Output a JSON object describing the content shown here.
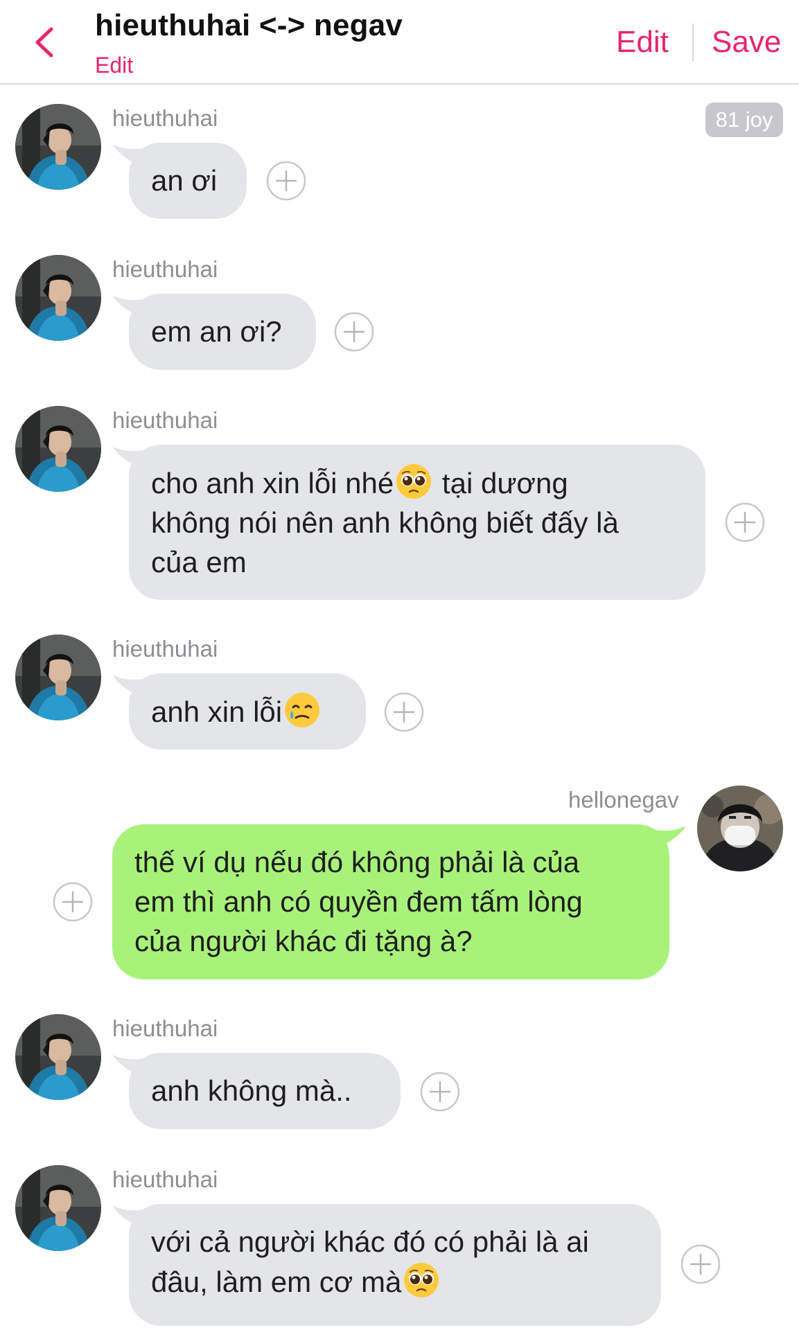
{
  "header": {
    "title": "hieuthuhai <-> negav",
    "subtitle": "Edit",
    "edit_label": "Edit",
    "save_label": "Save",
    "accent_color": "#e8256e"
  },
  "badge": "81 joy",
  "messages": [
    {
      "sender": "hieuthuhai",
      "side": "incoming",
      "lines": [
        "an ơi"
      ]
    },
    {
      "sender": "hieuthuhai",
      "side": "incoming",
      "lines": [
        "em an ơi?"
      ]
    },
    {
      "sender": "hieuthuhai",
      "side": "incoming",
      "line1a": "cho anh xin lỗi nhé",
      "line1_emoji": "pleading-face-emoji",
      "line1b": " tại dương",
      "lines": [
        "không nói nên anh không biết đấy là",
        "của em"
      ]
    },
    {
      "sender": "hieuthuhai",
      "side": "incoming",
      "text": "anh xin lỗi",
      "emoji": "crying-smile-emoji"
    },
    {
      "sender": "hellonegav",
      "side": "outgoing",
      "lines": [
        "thế ví dụ nếu đó không phải là của",
        "em thì anh có quyền đem tấm lòng",
        "của người khác đi tặng à?"
      ]
    },
    {
      "sender": "hieuthuhai",
      "side": "incoming",
      "lines": [
        "anh không mà.."
      ]
    },
    {
      "sender": "hieuthuhai",
      "side": "incoming",
      "lines": [
        "với cả người khác đó có phải là ai"
      ],
      "line2": "đâu, làm em cơ mà",
      "line2_emoji": "pleading-face-emoji"
    }
  ],
  "colors": {
    "incoming_bubble": "#e4e5e9",
    "outgoing_bubble": "#a9f27a",
    "sender_text": "#8d8d92"
  }
}
